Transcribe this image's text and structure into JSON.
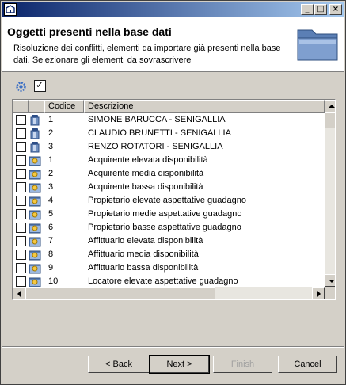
{
  "window": {
    "minimize_glyph": "_",
    "maximize_glyph": "□",
    "close_glyph": "×"
  },
  "header": {
    "title": "Oggetti presenti nella base dati",
    "description": "Risoluzione dei conflitti, elementi da importare già presenti nella base dati. Selezionare gli elementi da sovrascrivere",
    "icon": "folder-icon"
  },
  "toolbar": {
    "settings_icon": "gear-icon",
    "select_all_check": "✓",
    "select_all_checked": true
  },
  "table": {
    "columns": [
      "",
      "",
      "Codice",
      "Descrizione"
    ],
    "rows": [
      {
        "icon": "user-icon",
        "code": "1",
        "description": "SIMONE BARUCCA - SENIGALLIA"
      },
      {
        "icon": "user-icon",
        "code": "2",
        "description": "CLAUDIO BRUNETTI - SENIGALLIA"
      },
      {
        "icon": "user-icon",
        "code": "3",
        "description": "RENZO ROTATORI - SENIGALLIA"
      },
      {
        "icon": "category-icon",
        "code": "1",
        "description": "Acquirente elevata disponibilità"
      },
      {
        "icon": "category-icon",
        "code": "2",
        "description": "Acquirente media disponibilità"
      },
      {
        "icon": "category-icon",
        "code": "3",
        "description": "Acquirente bassa disponibilità"
      },
      {
        "icon": "category-icon",
        "code": "4",
        "description": "Propietario elevate aspettative guadagno"
      },
      {
        "icon": "category-icon",
        "code": "5",
        "description": "Propietario medie aspettative guadagno"
      },
      {
        "icon": "category-icon",
        "code": "6",
        "description": "Propietario basse aspettative guadagno"
      },
      {
        "icon": "category-icon",
        "code": "7",
        "description": "Affittuario elevata disponibilità"
      },
      {
        "icon": "category-icon",
        "code": "8",
        "description": "Affittuario media disponibilità"
      },
      {
        "icon": "category-icon",
        "code": "9",
        "description": "Affittuario bassa disponibilità"
      },
      {
        "icon": "category-icon",
        "code": "10",
        "description": "Locatore elevate aspettative guadagno"
      }
    ]
  },
  "buttons": {
    "back": "< Back",
    "next": "Next >",
    "finish": "Finish",
    "cancel": "Cancel"
  }
}
